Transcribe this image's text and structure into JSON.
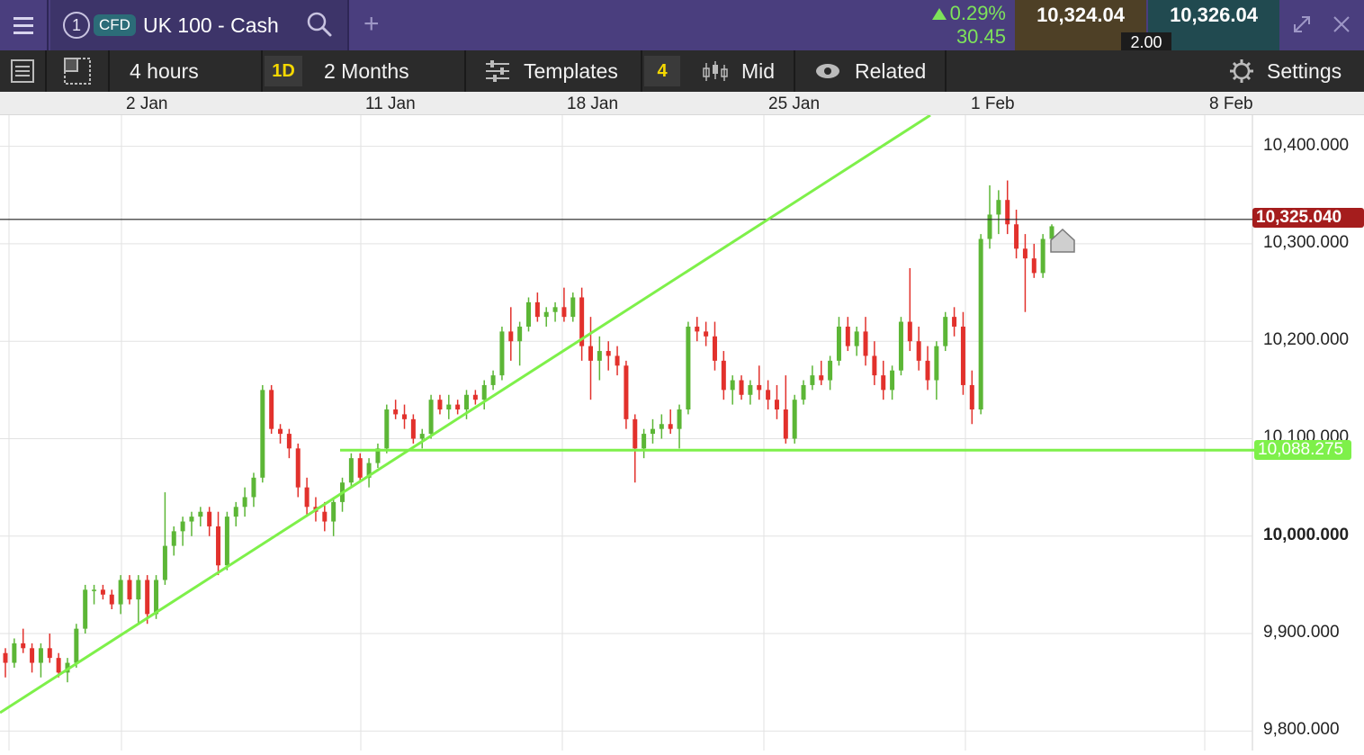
{
  "header": {
    "instrument_number": "1",
    "badge": "CFD",
    "instrument_name": "UK 100 - Cash",
    "change_percent": "0.29%",
    "change_points": "30.45",
    "sell_price": "10,324.04",
    "buy_price": "10,326.04",
    "spread": "2.00",
    "icons": [
      "menu-icon",
      "search-icon",
      "plus-icon",
      "expand-icon",
      "close-icon"
    ],
    "up_color": "#7ee35a"
  },
  "toolbar": {
    "interval": "4 hours",
    "interval_badge": "1D",
    "range": "2 Months",
    "templates": "Templates",
    "templates_badge": "4",
    "price_type": "Mid",
    "related": "Related",
    "settings": "Settings"
  },
  "chart_data": {
    "type": "candlestick",
    "x_labels": [
      "2 Jan",
      "11 Jan",
      "18 Jan",
      "25 Jan",
      "1 Feb",
      "8 Feb"
    ],
    "y_ticks": [
      "10,400.000",
      "10,300.000",
      "10,200.000",
      "10,100.000",
      "10,000.000",
      "9,900.000",
      "9,800.000"
    ],
    "y_tick_values": [
      10400,
      10300,
      10200,
      10100,
      10000,
      9900,
      9800
    ],
    "ylim": [
      9780,
      10432
    ],
    "current_price_label": "10,325.040",
    "current_price": 10325.04,
    "support_label": "10,088.275",
    "support_price": 10088.275,
    "up_color": "#5cb636",
    "down_color": "#e2312c",
    "trendline_color": "#7ef04a",
    "current_price_color": "#a51d1d",
    "grid": true,
    "candles": [
      [
        9880,
        9885,
        9855,
        9870
      ],
      [
        9870,
        9895,
        9865,
        9890
      ],
      [
        9890,
        9905,
        9880,
        9885
      ],
      [
        9885,
        9890,
        9860,
        9870
      ],
      [
        9870,
        9890,
        9855,
        9885
      ],
      [
        9885,
        9900,
        9870,
        9875
      ],
      [
        9875,
        9880,
        9855,
        9860
      ],
      [
        9860,
        9875,
        9850,
        9870
      ],
      [
        9870,
        9910,
        9865,
        9905
      ],
      [
        9905,
        9950,
        9900,
        9945
      ],
      [
        9945,
        9950,
        9930,
        9945
      ],
      [
        9945,
        9950,
        9935,
        9940
      ],
      [
        9940,
        9945,
        9925,
        9930
      ],
      [
        9930,
        9960,
        9920,
        9955
      ],
      [
        9955,
        9960,
        9930,
        9935
      ],
      [
        9935,
        9960,
        9910,
        9955
      ],
      [
        9955,
        9960,
        9910,
        9920
      ],
      [
        9920,
        9960,
        9915,
        9955
      ],
      [
        9955,
        10045,
        9950,
        9990
      ],
      [
        9990,
        10010,
        9980,
        10005
      ],
      [
        10005,
        10020,
        9990,
        10015
      ],
      [
        10015,
        10025,
        10000,
        10020
      ],
      [
        10020,
        10030,
        10010,
        10025
      ],
      [
        10025,
        10030,
        10000,
        10010
      ],
      [
        10010,
        10025,
        9960,
        9970
      ],
      [
        9970,
        10025,
        9965,
        10020
      ],
      [
        10020,
        10035,
        10010,
        10030
      ],
      [
        10030,
        10050,
        10020,
        10040
      ],
      [
        10040,
        10065,
        10030,
        10060
      ],
      [
        10060,
        10155,
        10055,
        10150
      ],
      [
        10150,
        10155,
        10105,
        10110
      ],
      [
        10110,
        10115,
        10095,
        10105
      ],
      [
        10105,
        10110,
        10080,
        10090
      ],
      [
        10090,
        10095,
        10040,
        10050
      ],
      [
        10050,
        10060,
        10020,
        10030
      ],
      [
        10030,
        10040,
        10015,
        10025
      ],
      [
        10025,
        10035,
        10005,
        10015
      ],
      [
        10015,
        10040,
        10000,
        10035
      ],
      [
        10035,
        10060,
        10025,
        10055
      ],
      [
        10055,
        10085,
        10050,
        10080
      ],
      [
        10080,
        10085,
        10055,
        10060
      ],
      [
        10060,
        10080,
        10050,
        10075
      ],
      [
        10075,
        10095,
        10070,
        10090
      ],
      [
        10090,
        10135,
        10085,
        10130
      ],
      [
        10130,
        10140,
        10120,
        10125
      ],
      [
        10125,
        10135,
        10110,
        10120
      ],
      [
        10120,
        10125,
        10095,
        10100
      ],
      [
        10100,
        10110,
        10090,
        10105
      ],
      [
        10105,
        10145,
        10100,
        10140
      ],
      [
        10140,
        10145,
        10125,
        10130
      ],
      [
        10130,
        10145,
        10120,
        10135
      ],
      [
        10135,
        10140,
        10125,
        10130
      ],
      [
        10130,
        10150,
        10120,
        10145
      ],
      [
        10145,
        10150,
        10135,
        10140
      ],
      [
        10140,
        10160,
        10130,
        10155
      ],
      [
        10155,
        10170,
        10150,
        10165
      ],
      [
        10165,
        10215,
        10160,
        10210
      ],
      [
        10210,
        10235,
        10180,
        10200
      ],
      [
        10200,
        10220,
        10175,
        10215
      ],
      [
        10215,
        10245,
        10210,
        10240
      ],
      [
        10240,
        10250,
        10220,
        10225
      ],
      [
        10225,
        10235,
        10215,
        10230
      ],
      [
        10230,
        10240,
        10220,
        10235
      ],
      [
        10235,
        10255,
        10220,
        10225
      ],
      [
        10225,
        10250,
        10220,
        10245
      ],
      [
        10245,
        10255,
        10180,
        10195
      ],
      [
        10195,
        10225,
        10140,
        10180
      ],
      [
        10180,
        10205,
        10160,
        10190
      ],
      [
        10190,
        10200,
        10170,
        10185
      ],
      [
        10185,
        10195,
        10165,
        10175
      ],
      [
        10175,
        10180,
        10110,
        10120
      ],
      [
        10120,
        10125,
        10055,
        10090
      ],
      [
        10090,
        10110,
        10080,
        10105
      ],
      [
        10105,
        10120,
        10095,
        10110
      ],
      [
        10110,
        10125,
        10100,
        10115
      ],
      [
        10115,
        10130,
        10105,
        10110
      ],
      [
        10110,
        10135,
        10090,
        10130
      ],
      [
        10130,
        10220,
        10125,
        10215
      ],
      [
        10215,
        10225,
        10200,
        10210
      ],
      [
        10210,
        10220,
        10195,
        10205
      ],
      [
        10205,
        10220,
        10170,
        10180
      ],
      [
        10180,
        10190,
        10140,
        10150
      ],
      [
        10150,
        10165,
        10135,
        10160
      ],
      [
        10160,
        10165,
        10140,
        10145
      ],
      [
        10145,
        10160,
        10135,
        10155
      ],
      [
        10155,
        10175,
        10140,
        10150
      ],
      [
        10150,
        10160,
        10130,
        10140
      ],
      [
        10140,
        10155,
        10120,
        10130
      ],
      [
        10130,
        10165,
        10095,
        10100
      ],
      [
        10100,
        10145,
        10095,
        10140
      ],
      [
        10140,
        10160,
        10135,
        10155
      ],
      [
        10155,
        10175,
        10150,
        10165
      ],
      [
        10165,
        10180,
        10155,
        10160
      ],
      [
        10160,
        10185,
        10150,
        10180
      ],
      [
        10180,
        10225,
        10175,
        10215
      ],
      [
        10215,
        10225,
        10190,
        10195
      ],
      [
        10195,
        10215,
        10185,
        10210
      ],
      [
        10210,
        10225,
        10175,
        10185
      ],
      [
        10185,
        10200,
        10155,
        10165
      ],
      [
        10165,
        10180,
        10140,
        10150
      ],
      [
        10150,
        10175,
        10140,
        10170
      ],
      [
        10170,
        10225,
        10165,
        10220
      ],
      [
        10220,
        10275,
        10190,
        10200
      ],
      [
        10200,
        10215,
        10170,
        10180
      ],
      [
        10180,
        10195,
        10150,
        10160
      ],
      [
        10160,
        10200,
        10140,
        10195
      ],
      [
        10195,
        10230,
        10190,
        10225
      ],
      [
        10225,
        10235,
        10205,
        10215
      ],
      [
        10215,
        10230,
        10145,
        10155
      ],
      [
        10155,
        10170,
        10115,
        10130
      ],
      [
        10130,
        10310,
        10125,
        10305
      ],
      [
        10305,
        10360,
        10295,
        10330
      ],
      [
        10330,
        10355,
        10310,
        10345
      ],
      [
        10345,
        10365,
        10310,
        10320
      ],
      [
        10320,
        10335,
        10285,
        10295
      ],
      [
        10295,
        10310,
        10230,
        10285
      ],
      [
        10285,
        10300,
        10265,
        10270
      ],
      [
        10270,
        10310,
        10265,
        10305
      ],
      [
        10305,
        10320,
        10295,
        10318
      ]
    ]
  }
}
